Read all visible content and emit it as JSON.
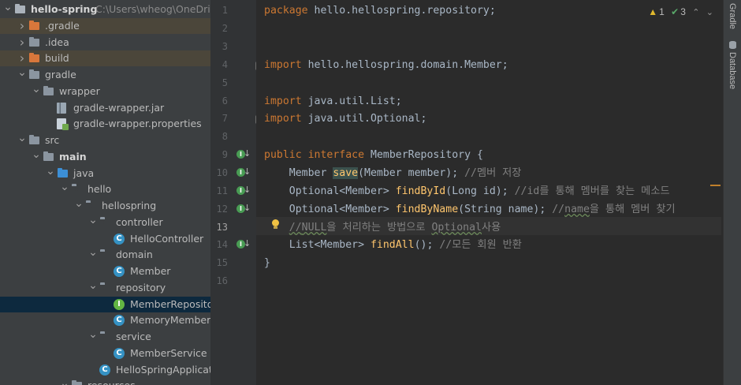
{
  "project": {
    "name": "hello-spring",
    "path": "C:\\Users\\wheog\\OneDrive",
    "tree": [
      {
        "label": "hello-spring",
        "depth": 0,
        "chevron": "v",
        "icon": "project-folder",
        "hl": false
      },
      {
        "label": ".gradle",
        "depth": 1,
        "chevron": ">",
        "icon": "folder-orange",
        "hl": true
      },
      {
        "label": ".idea",
        "depth": 1,
        "chevron": ">",
        "icon": "folder-gray",
        "hl": false
      },
      {
        "label": "build",
        "depth": 1,
        "chevron": ">",
        "icon": "folder-orange",
        "hl": true
      },
      {
        "label": "gradle",
        "depth": 1,
        "chevron": "v",
        "icon": "folder-gray",
        "hl": false
      },
      {
        "label": "wrapper",
        "depth": 2,
        "chevron": "v",
        "icon": "folder-gray",
        "hl": false
      },
      {
        "label": "gradle-wrapper.jar",
        "depth": 3,
        "chevron": "",
        "icon": "jar-file",
        "hl": false
      },
      {
        "label": "gradle-wrapper.properties",
        "depth": 3,
        "chevron": "",
        "icon": "properties-file",
        "hl": false
      },
      {
        "label": "src",
        "depth": 1,
        "chevron": "v",
        "icon": "folder-gray",
        "hl": false
      },
      {
        "label": "main",
        "depth": 2,
        "chevron": "v",
        "icon": "folder-gray",
        "bold": true,
        "hl": false
      },
      {
        "label": "java",
        "depth": 3,
        "chevron": "v",
        "icon": "folder-blue",
        "hl": false
      },
      {
        "label": "hello",
        "depth": 4,
        "chevron": "v",
        "icon": "package",
        "hl": false
      },
      {
        "label": "hellospring",
        "depth": 5,
        "chevron": "v",
        "icon": "package",
        "hl": false
      },
      {
        "label": "controller",
        "depth": 6,
        "chevron": "v",
        "icon": "package",
        "hl": false
      },
      {
        "label": "HelloController",
        "depth": 7,
        "chevron": "",
        "icon": "class-c",
        "hl": false
      },
      {
        "label": "domain",
        "depth": 6,
        "chevron": "v",
        "icon": "package",
        "hl": false
      },
      {
        "label": "Member",
        "depth": 7,
        "chevron": "",
        "icon": "class-c",
        "hl": false
      },
      {
        "label": "repository",
        "depth": 6,
        "chevron": "v",
        "icon": "package",
        "hl": false
      },
      {
        "label": "MemberRepository",
        "depth": 7,
        "chevron": "",
        "icon": "interface-i",
        "hl": false,
        "selected": true
      },
      {
        "label": "MemoryMemberRepository",
        "depth": 7,
        "chevron": "",
        "icon": "class-c",
        "hl": false
      },
      {
        "label": "service",
        "depth": 6,
        "chevron": "v",
        "icon": "package",
        "hl": false
      },
      {
        "label": "MemberService",
        "depth": 7,
        "chevron": "",
        "icon": "class-c",
        "hl": false
      },
      {
        "label": "HelloSpringApplication",
        "depth": 6,
        "chevron": "",
        "icon": "app-class",
        "hl": false
      },
      {
        "label": "resources",
        "depth": 4,
        "chevron": "v",
        "icon": "folder-gray",
        "hl": false
      }
    ]
  },
  "status": {
    "warnings": "1",
    "checks": "3"
  },
  "right_tabs": {
    "gradle": "Gradle",
    "database": "Database"
  },
  "line_numbers": [
    "1",
    "2",
    "3",
    "4",
    "5",
    "6",
    "7",
    "8",
    "9",
    "10",
    "11",
    "12",
    "13",
    "14",
    "15",
    "16"
  ],
  "current_line": 13,
  "code": {
    "l1": {
      "kw": "package",
      "rest": " hello.hellospring.repository;"
    },
    "l4": {
      "kw": "import",
      "rest": " hello.hellospring.domain.Member;"
    },
    "l6": {
      "kw": "import",
      "rest": " java.util.List;"
    },
    "l7": {
      "kw": "import",
      "rest": " java.util.Optional;"
    },
    "l9": {
      "kw1": "public",
      "kw2": "interface",
      "name": " MemberRepository {"
    },
    "l10": {
      "type": "    Member ",
      "fn": "save",
      "args": "(Member member); ",
      "comment": "//멤버 저장"
    },
    "l11": {
      "type": "    Optional<Member> ",
      "fn": "findById",
      "args": "(Long id); ",
      "comment": "//id를 통해 멤버를 찾는 메소드"
    },
    "l12": {
      "type": "    Optional<Member> ",
      "fn": "findByName",
      "args": "(String name); ",
      "c1": "//",
      "c2": "name",
      "c3": "을 통해 멤버 찾기"
    },
    "l13": {
      "pre": "    ",
      "c1": "//",
      "c2": "NULL",
      "c3": "을 처리하는 방법으로 ",
      "c4": "Optional",
      "c5": "사용"
    },
    "l14": {
      "type": "    List<Member> ",
      "fn": "findAll",
      "args": "(); ",
      "comment": "//모든 회원 반환"
    },
    "l15": {
      "text": "}"
    }
  }
}
